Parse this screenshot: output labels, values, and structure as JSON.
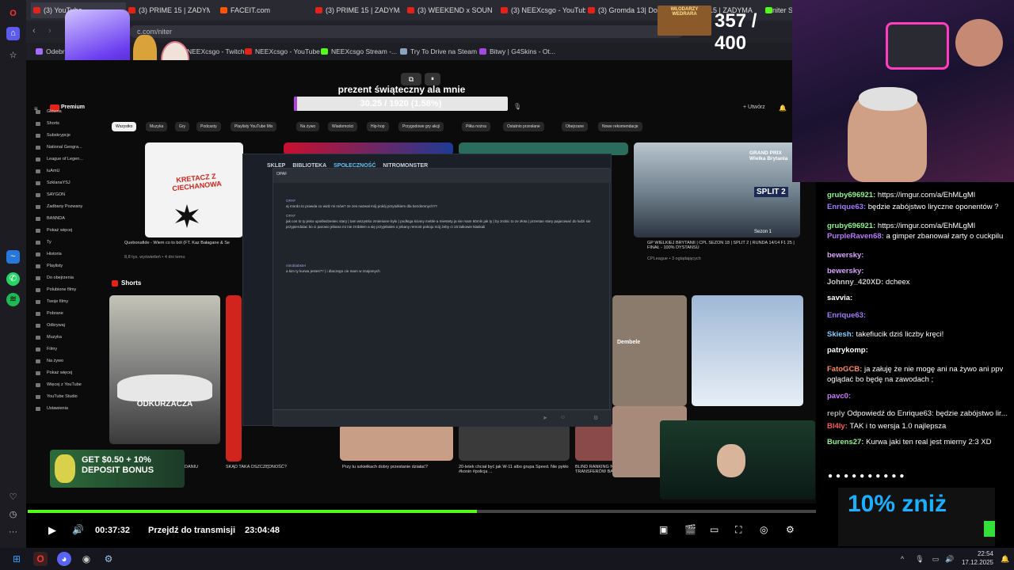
{
  "tabs": [
    {
      "label": "(3) YouTube"
    },
    {
      "label": "(3) PRIME 15 | ZADYMA"
    },
    {
      "label": "FACEIT.com"
    },
    {
      "label": "(3) PRIME 15 | ZADYMA"
    },
    {
      "label": "(3) WEEKEND x SOUN"
    },
    {
      "label": "(3) NEEXcsgo - YouTube"
    },
    {
      "label": "(3) Gromda 13| Domi"
    },
    {
      "label": "15 | ZADYMA"
    },
    {
      "label": "niter S"
    }
  ],
  "address": {
    "url": "c.com/niter"
  },
  "bookmarks": [
    {
      "label": "Odebr"
    },
    {
      "label": "NEEXcsgo - Twitch"
    },
    {
      "label": "NEEXcsgo - YouTube"
    },
    {
      "label": "NEEXcsgo Stream -..."
    },
    {
      "label": "Try To Drive na Steam"
    },
    {
      "label": "Bitwy | G4Skins - Ot..."
    }
  ],
  "gift": {
    "title": "prezent świąteczny ala mnie",
    "progress_text": "30.25 / 1920 (1.58%)",
    "progress": 0.0158
  },
  "counter": {
    "badge": "WŁODARZY WEDRARA",
    "value": "357 / 400"
  },
  "youtube": {
    "brand": "Premium",
    "chips": [
      "Wszystko",
      "Muzyka",
      "Gry",
      "Podcasty",
      "Playlisty YouTube Mix",
      "Na żywo",
      "Wiadomości",
      "Hip-hop",
      "Przygodowe gry akcji",
      "Piłka nożna",
      "Ostatnio przesłane",
      "Obejrzane",
      "Nowe rekomendacje"
    ],
    "sidebar": [
      "Główna",
      "Shorts",
      "Subskrypcje",
      "National Geogra...",
      "League of Legen...",
      "luAmU",
      "SzklanaYSJ",
      "SAYGON",
      "Zadbany Pozwany",
      "BANNDA",
      "Pokaż więcej",
      "Ty",
      "Historia",
      "Playlisty",
      "Do obejrzenia",
      "Polubione filmy",
      "Twoje filmy",
      "Pobrane",
      "Odkrywaj",
      "Muzyka",
      "Filmy",
      "Na żywo",
      "Pokaż więcej",
      "Więcej z YouTube",
      "YouTube Studio",
      "Ustawienia"
    ],
    "video1_title": "Quebonafide - Wiem co to ból (FT. Kaz Bałagane & Se",
    "video1_meta": "8,8 tys. wyświetleń • 4 dni temu",
    "thumb_text": "KRETACZ Z CIECHANOWA",
    "f1_title": "GP WIELKIEJ BRYTANII | CPL SEZON 18 | SPLIT 2 | RUNDA 14/14 F1 25 | FINAŁ - 100% DYSTANSU",
    "f1_meta": "CPLeague • 3 oglądających",
    "f1_thumb": "GRAND PRIX Wielka Brytania",
    "split": "SPLIT 2",
    "sezon": "Sezon 1",
    "shorts_label": "Shorts",
    "shorts": [
      {
        "text": "ODKURZACZA",
        "title": "DANIU"
      },
      {
        "text": "",
        "title": "SKĄD TAKA OSZCZĘDNOŚĆ?"
      },
      {
        "text": "",
        "title": "Przy tu szkiełkach dobry przestanie działać?"
      },
      {
        "text": "",
        "title": "20-letek chciał być jak W-11 albo grupa Speed. Nie pykło #konin #policja ..."
      },
      {
        "text": "Dembele",
        "title": "BLIND RANKING NAJGORSZYCH TRANSFERÓW BARCY #shorts"
      }
    ],
    "deposit": "GET $0.50 + 10% DEPOSIT BONUS"
  },
  "steam": {
    "nav": [
      "SKLEP",
      "BIBLIOTEKA",
      "SPOŁECZNOŚĆ",
      "NITROMONSTER"
    ],
    "chat_name": "OPAF",
    "messages": [
      {
        "user": "OPAF",
        "text": "ej mordo to prawda co widz mi mów? ze zes nazwał mój pokój przytulkiem dla bezdomnych??"
      },
      {
        "user": "OPAF",
        "text": "jak cos to ty jestu upośledzeniec stary | tam wszystko zmieniane było | podłoga ściany meble a miestety ja nie mam 50mln jak ty | by zrobic to ze złota | przestan stary pajacować do ludzi sie przypierdalac bo ci parowo jebana mi nie zrobiłem a się przyjebales o jebany remont pokoju mój żeby ci 15 latkowie klaskali"
      },
      {
        "user": "nitroblabster",
        "text": "a kim ty kurwa jestes?? | i dlaczego cie mam w znajomych"
      }
    ]
  },
  "chat": [
    {
      "user": "gruby696921:",
      "text": "https://imgur.com/a/EhMLgMl",
      "color": "#8ef58e"
    },
    {
      "user": "Enrique63:",
      "text": "będzie zabójstwo liryczne oponentów ?",
      "color": "#a37bff"
    },
    {
      "user": "gruby696921:",
      "text": "https://imgur.com/a/EhMLgMl",
      "color": "#8ef58e"
    },
    {
      "user": "PurpleRaven68:",
      "text": "a gimper zbanował zarty o cuckpilu",
      "color": "#b77bff"
    },
    {
      "user": "bewersky:",
      "text": "",
      "color": "#d7a3ff"
    },
    {
      "user": "bewersky:",
      "text": "",
      "color": "#d7a3ff"
    },
    {
      "user": "Johnny_420XD:",
      "text": "dcheex",
      "color": "#c8c8c8"
    },
    {
      "user": "savvia:",
      "text": "",
      "color": "#ffffff"
    },
    {
      "user": "Enrique63:",
      "text": "",
      "color": "#a37bff"
    },
    {
      "user": "Skiesh:",
      "text": "takefiucik dziś liczby kręci!",
      "color": "#7dd3ff"
    },
    {
      "user": "patrykomp:",
      "text": "",
      "color": "#ffffff"
    },
    {
      "user": "FatoGCB:",
      "text": "ja załuję że nie mogę ani na żywo ani ppv oglądać bo będę na zawodach ;",
      "color": "#ff8a65"
    },
    {
      "user": "pavc0:",
      "text": "",
      "color": "#d07bff"
    },
    {
      "user": "reply",
      "text": "Odpowiedź do Enrique63: będzie zabójstwo lir...",
      "color": "#aaaaaa"
    },
    {
      "user": "Bl4ly:",
      "text": "TAK i to wersja 1.0 najlepsza",
      "color": "#ff5a5a"
    },
    {
      "user": "Burens27:",
      "text": "Kurwa jaki ten real jest mierny 2:3 XD",
      "color": "#8ef58e"
    }
  ],
  "promo": "10% zniż",
  "player": {
    "time": "00:37:32",
    "live_label": "Przejdź do transmisji",
    "end_time": "23:04:48",
    "progress": 0.57
  },
  "taskbar": {
    "time": "22:54",
    "date": "17.12.2025"
  }
}
